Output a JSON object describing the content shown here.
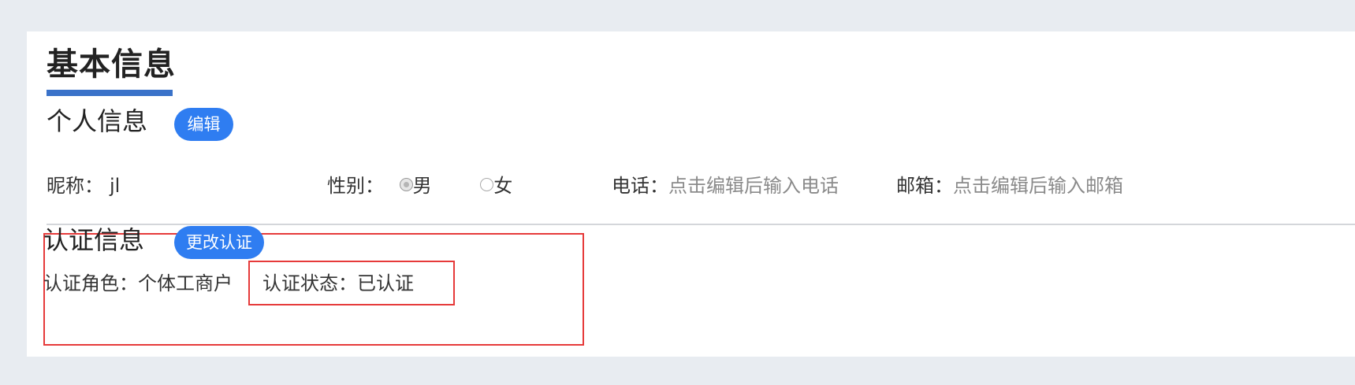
{
  "page": {
    "title": "基本信息"
  },
  "personal": {
    "section_title": "个人信息",
    "edit_button": "编辑",
    "nickname_label": "昵称：",
    "nickname_value": "jl",
    "gender_label": "性别：",
    "gender_options": [
      "男",
      "女"
    ],
    "gender_selected": "男",
    "phone_label": "电话：",
    "phone_placeholder": "点击编辑后输入电话",
    "email_label": "邮箱：",
    "email_placeholder": "点击编辑后输入邮箱"
  },
  "certification": {
    "section_title": "认证信息",
    "change_button": "更改认证",
    "role_label": "认证角色：",
    "role_value": "个体工商户",
    "status_label": "认证状态：",
    "status_value": "已认证"
  },
  "colors": {
    "accent": "#2f7df1",
    "title_underline": "#3a72c9",
    "highlight_outline": "#e63a3a",
    "background": "#e8ecf1"
  }
}
